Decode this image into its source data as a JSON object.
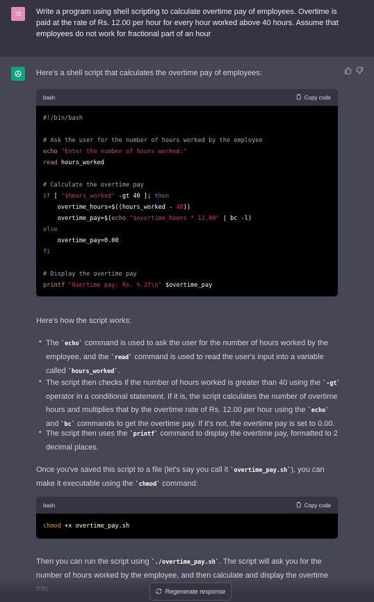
{
  "user": {
    "avatar": "TE",
    "message": "Write a program using shell scripting to calculate overtime pay of employees. Overtime is paid at the rate of Rs. 12.00 per hour for every hour worked above 40 hours. Assume that employees do not work for fractional part of an hour"
  },
  "assistant": {
    "intro": "Here's a shell script that calculates the overtime pay of employees:",
    "code1": {
      "lang": "bash",
      "copy_label": "Copy code",
      "lines": [
        "#!/bin/bash",
        "",
        "# Ask the user for the number of hours worked by the employee",
        "echo \"Enter the number of hours worked:\"",
        "read hours_worked",
        "",
        "# Calculate the overtime pay",
        "if [ \"$hours_worked\" -gt 40 ]; then",
        "    overtime_hours=$((hours_worked - 40))",
        "    overtime_pay=$(echo \"$overtime_hours * 12.00\" | bc -l)",
        "else",
        "    overtime_pay=0.00",
        "fi",
        "",
        "# Display the overtime pay",
        "printf \"Overtime pay: Rs. %.2f\\n\" $overtime_pay"
      ]
    },
    "how_heading": "Here's how the script works:",
    "bullets": [
      {
        "parts": [
          "The ",
          "`echo`",
          " command is used to ask the user for the number of hours worked by the employee, and the ",
          "`read`",
          " command is used to read the user's input into a variable called ",
          "`hours_worked`",
          "."
        ]
      },
      {
        "parts": [
          "The script then checks if the number of hours worked is greater than 40 using the ",
          "`-gt`",
          " operator in a conditional statement. If it is, the script calculates the number of overtime hours and multiplies that by the overtime rate of Rs. 12.00 per hour using the ",
          "`echo`",
          " and ",
          "`bc`",
          " commands to get the overtime pay. If it's not, the overtime pay is set to 0.00."
        ]
      },
      {
        "parts": [
          "The script then uses the ",
          "`printf`",
          " command to display the overtime pay, formatted to 2 decimal places."
        ]
      }
    ],
    "save_para": {
      "parts": [
        "Once you've saved this script to a file (let's say you call it ",
        "`overtime_pay.sh`",
        "), you can make it executable using the ",
        "`chmod`",
        " command:"
      ]
    },
    "code2": {
      "lang": "bash",
      "copy_label": "Copy code",
      "cmd": "chmod",
      "rest": " +x overtime_pay.sh"
    },
    "run_para": {
      "parts": [
        "Then you can run the script using ",
        "`./overtime_pay.sh`",
        ". The script will ask you for the number of hours worked by the employee, and then calculate and display the overtime pay."
      ]
    }
  },
  "regen_label": "Regenerate response",
  "icons": [
    "chatgpt-logo-icon",
    "thumbs-up-icon",
    "thumbs-down-icon",
    "clipboard-icon",
    "refresh-icon"
  ]
}
